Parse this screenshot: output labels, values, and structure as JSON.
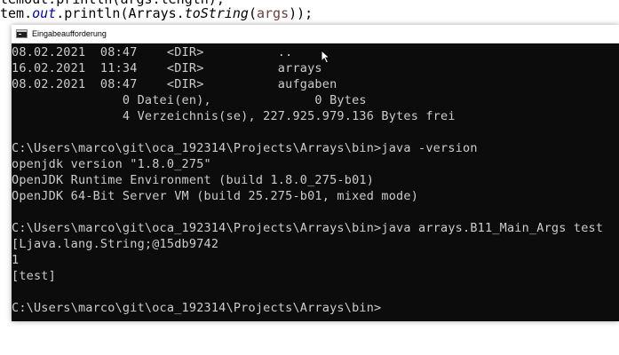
{
  "editor": {
    "line1": "temout.println(args.length);",
    "line2_prefix": "tem.",
    "line2_field": "out",
    "line2_mid": ".println(Arrays.",
    "line2_method": "toString",
    "line2_open": "(",
    "line2_arg": "args",
    "line2_close": "));"
  },
  "window": {
    "title": "Eingabeaufforderung"
  },
  "console": {
    "lines": [
      "08.02.2021  08:47    <DIR>          ..",
      "16.02.2021  11:34    <DIR>          arrays",
      "08.02.2021  08:47    <DIR>          aufgaben",
      "               0 Datei(en),              0 Bytes",
      "               4 Verzeichnis(se), 227.925.979.136 Bytes frei",
      "",
      "C:\\Users\\marco\\git\\oca_192314\\Projects\\Arrays\\bin>java -version",
      "openjdk version \"1.8.0_275\"",
      "OpenJDK Runtime Environment (build 1.8.0_275-b01)",
      "OpenJDK 64-Bit Server VM (build 25.275-b01, mixed mode)",
      "",
      "C:\\Users\\marco\\git\\oca_192314\\Projects\\Arrays\\bin>java arrays.B11_Main_Args test",
      "[Ljava.lang.String;@15db9742",
      "1",
      "[test]",
      "",
      "C:\\Users\\marco\\git\\oca_192314\\Projects\\Arrays\\bin>"
    ]
  },
  "colors": {
    "console_bg": "#0c0c0c",
    "console_fg": "#cccccc",
    "titlebar_bg": "#ffffff"
  },
  "icons": {
    "window_icon": "cmd-window-icon",
    "pointer": "mouse-pointer-icon"
  }
}
